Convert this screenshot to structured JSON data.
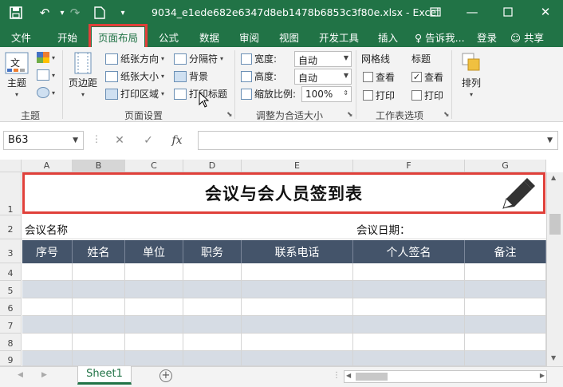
{
  "titlebar": {
    "title": "9034_e1ede682e6347d8eb1478b6853c3f80e.xlsx - Excel",
    "icons": [
      "save-icon",
      "undo-icon",
      "redo-icon",
      "new-file-icon",
      "customize-icon"
    ],
    "accent_color": "#217346"
  },
  "tabs": [
    {
      "label": "文件"
    },
    {
      "label": "开始"
    },
    {
      "label": "页面布局"
    },
    {
      "label": "公式"
    },
    {
      "label": "数据"
    },
    {
      "label": "审阅"
    },
    {
      "label": "视图"
    },
    {
      "label": "开发工具"
    },
    {
      "label": "插入"
    }
  ],
  "tabs_right": {
    "tell_me": "告诉我...",
    "login": "登录",
    "share": "共享"
  },
  "ribbon": {
    "themes": {
      "label": "主题",
      "group": "主题"
    },
    "page_setup": {
      "margins": "页边距",
      "orientation": "纸张方向",
      "size": "纸张大小",
      "print_area": "打印区域",
      "breaks": "分隔符",
      "background": "背景",
      "print_titles": "打印标题",
      "group": "页面设置"
    },
    "scale": {
      "width_label": "宽度:",
      "width_value": "自动",
      "height_label": "高度:",
      "height_value": "自动",
      "scale_label": "缩放比例:",
      "scale_value": "100%",
      "group": "调整为合适大小"
    },
    "sheet_options": {
      "gridlines": "网格线",
      "headings": "标题",
      "view": "查看",
      "print": "打印",
      "group": "工作表选项"
    },
    "arrange": {
      "label": "排列"
    }
  },
  "formula_bar": {
    "name_box": "B63",
    "cancel": "✕",
    "enter": "✓",
    "fx": "fx"
  },
  "grid": {
    "columns": [
      "A",
      "B",
      "C",
      "D",
      "E",
      "F",
      "G"
    ],
    "rows": [
      "1",
      "2",
      "3",
      "4",
      "5",
      "6",
      "7",
      "8",
      "9"
    ],
    "title": "会议与会人员签到表",
    "meeting_name_label": "会议名称",
    "meeting_date_label": "会议日期：",
    "headers": [
      "序号",
      "姓名",
      "单位",
      "职务",
      "联系电话",
      "个人签名",
      "备注"
    ],
    "header_color": "#44546a",
    "band_color": "#d6dce4"
  },
  "sheets": {
    "active": "Sheet1"
  }
}
